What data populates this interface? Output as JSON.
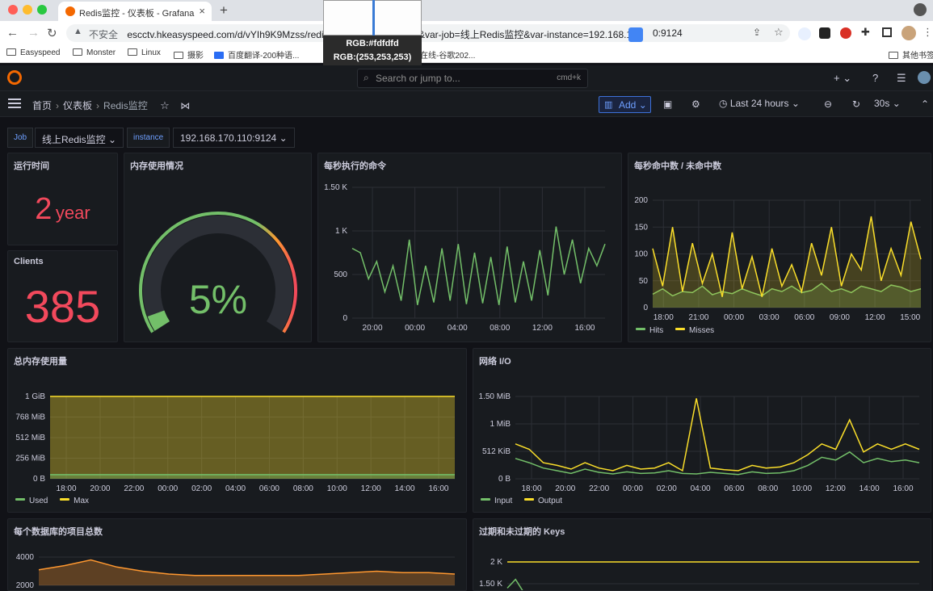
{
  "browser": {
    "tab_title": "Redis监控 - 仪表板 - Grafana",
    "insecure_label": "不安全",
    "url_left": "escctv.hkeasyspeed.com/d/vYIh9K9Mzss/redis",
    "url_right": "&var-job=线上Redis监控&var-instance=192.168.1",
    "url_tail": "0:9124",
    "bookmarks": [
      "Easyspeed",
      "Monster",
      "Linux",
      "摄影",
      "百度翻译-200种语...",
      "卫星在线-谷歌202...",
      "其他书签"
    ],
    "avatar_letter": "G"
  },
  "color_picker": {
    "hex": "RGB:#fdfdfd",
    "rgb": "RGB:(253,253,253)",
    "color": "#fdfdfd"
  },
  "grafana": {
    "search_placeholder": "Search or jump to...",
    "search_shortcut": "cmd+k",
    "breadcrumb": [
      "首页",
      "仪表板",
      "Redis监控"
    ],
    "add_label": "Add",
    "time_range": "Last 24 hours",
    "refresh_interval": "30s",
    "colors": {
      "green": "#73bf69",
      "yellow": "#fade2a",
      "red": "#f2495c",
      "orange": "#ff9830"
    }
  },
  "variables": {
    "job_label": "Job",
    "job_value": "线上Redis监控",
    "instance_label": "instance",
    "instance_value": "192.168.170.110:9124"
  },
  "panels": {
    "uptime": {
      "title": "运行时间",
      "value": "2",
      "unit": "year"
    },
    "clients": {
      "title": "Clients",
      "value": "385"
    },
    "memory_gauge": {
      "title": "内存使用情况",
      "value": "5%",
      "fraction": 0.05
    },
    "commands": {
      "title": "每秒执行的命令"
    },
    "hits": {
      "title": "每秒命中数 / 未命中数"
    },
    "total_memory": {
      "title": "总内存使用量"
    },
    "network": {
      "title": "网络 I/O"
    },
    "db_items": {
      "title": "每个数据库的项目总数"
    },
    "keys": {
      "title": "过期和未过期的 Keys"
    }
  },
  "chart_data": [
    {
      "type": "line",
      "name": "commands",
      "title": "每秒执行的命令",
      "x": [
        "20:00",
        "00:00",
        "04:00",
        "08:00",
        "12:00",
        "16:00"
      ],
      "yticks": [
        "0",
        "500",
        "1 K",
        "1.50 K"
      ],
      "ylim": [
        0,
        1500
      ],
      "series": [
        {
          "values": [
            800,
            750,
            450,
            650,
            300,
            600,
            200,
            900,
            150,
            600,
            180,
            800,
            200,
            850,
            160,
            750,
            170,
            700,
            150,
            820,
            180,
            650,
            200,
            780,
            260,
            1050,
            500,
            900,
            400,
            800,
            600,
            850
          ]
        }
      ],
      "grid": true
    },
    {
      "type": "area",
      "name": "hits",
      "title": "每秒命中数 / 未命中数",
      "x": [
        "18:00",
        "21:00",
        "00:00",
        "03:00",
        "06:00",
        "09:00",
        "12:00",
        "15:00"
      ],
      "yticks": [
        "0",
        "50",
        "100",
        "150",
        "200"
      ],
      "ylim": [
        0,
        200
      ],
      "series": [
        {
          "name": "Hits",
          "values": [
            25,
            35,
            22,
            30,
            28,
            40,
            24,
            30,
            26,
            35,
            28,
            22,
            35,
            30,
            40,
            28,
            32,
            45,
            30,
            35,
            28,
            40,
            35,
            30,
            42,
            38,
            30,
            35
          ]
        },
        {
          "name": "Misses",
          "values": [
            110,
            40,
            150,
            30,
            120,
            45,
            100,
            20,
            140,
            35,
            95,
            20,
            110,
            40,
            80,
            30,
            120,
            60,
            150,
            40,
            100,
            70,
            170,
            50,
            110,
            60,
            160,
            90
          ]
        }
      ],
      "grid": true
    },
    {
      "type": "area",
      "name": "total_memory",
      "title": "总内存使用量",
      "x": [
        "18:00",
        "20:00",
        "22:00",
        "00:00",
        "02:00",
        "04:00",
        "06:00",
        "08:00",
        "10:00",
        "12:00",
        "14:00",
        "16:00"
      ],
      "yticks": [
        "0 B",
        "256 MiB",
        "512 MiB",
        "768 MiB",
        "1 GiB"
      ],
      "ylim": [
        0,
        1024
      ],
      "series": [
        {
          "name": "Used",
          "values": [
            51,
            51,
            51,
            51,
            51,
            51,
            51,
            51,
            51,
            51,
            51,
            51
          ]
        },
        {
          "name": "Max",
          "values": [
            1024,
            1024,
            1024,
            1024,
            1024,
            1024,
            1024,
            1024,
            1024,
            1024,
            1024,
            1024
          ]
        }
      ],
      "grid": true
    },
    {
      "type": "line",
      "name": "network",
      "title": "网络 I/O",
      "x": [
        "18:00",
        "20:00",
        "22:00",
        "00:00",
        "02:00",
        "04:00",
        "06:00",
        "08:00",
        "10:00",
        "12:00",
        "14:00",
        "16:00"
      ],
      "yticks": [
        "0 B",
        "512 KiB",
        "1 MiB",
        "1.50 MiB"
      ],
      "ylim": [
        0,
        1536
      ],
      "series": [
        {
          "name": "Input",
          "values": [
            380,
            300,
            200,
            150,
            100,
            180,
            120,
            90,
            130,
            100,
            110,
            150,
            100,
            90,
            120,
            100,
            80,
            130,
            100,
            110,
            150,
            250,
            400,
            350,
            500,
            300,
            380,
            320,
            350,
            300
          ]
        },
        {
          "name": "Output",
          "values": [
            650,
            550,
            300,
            250,
            180,
            300,
            200,
            150,
            250,
            180,
            200,
            300,
            150,
            1500,
            200,
            170,
            150,
            250,
            200,
            220,
            300,
            450,
            650,
            550,
            1100,
            500,
            650,
            550,
            650,
            550
          ]
        }
      ],
      "grid": true
    },
    {
      "type": "area",
      "name": "db_items",
      "title": "每个数据库的项目总数",
      "yticks": [
        "2000",
        "4000"
      ],
      "series": [
        {
          "values": [
            3100,
            3400,
            3800,
            3300,
            3000,
            2800,
            2700,
            2700,
            2700,
            2700,
            2700,
            2800,
            2900,
            3000,
            2900,
            2900,
            2800
          ]
        }
      ]
    },
    {
      "type": "line",
      "name": "keys",
      "title": "过期和未过期的 Keys",
      "yticks": [
        "1.50 K",
        "2 K"
      ],
      "series": [
        {
          "values": [
            2000,
            2000,
            2000,
            2000,
            2000,
            2000,
            2000,
            2000,
            2000,
            2000,
            2000,
            2000
          ]
        },
        {
          "values": [
            1400,
            1600,
            1300
          ]
        }
      ]
    }
  ]
}
